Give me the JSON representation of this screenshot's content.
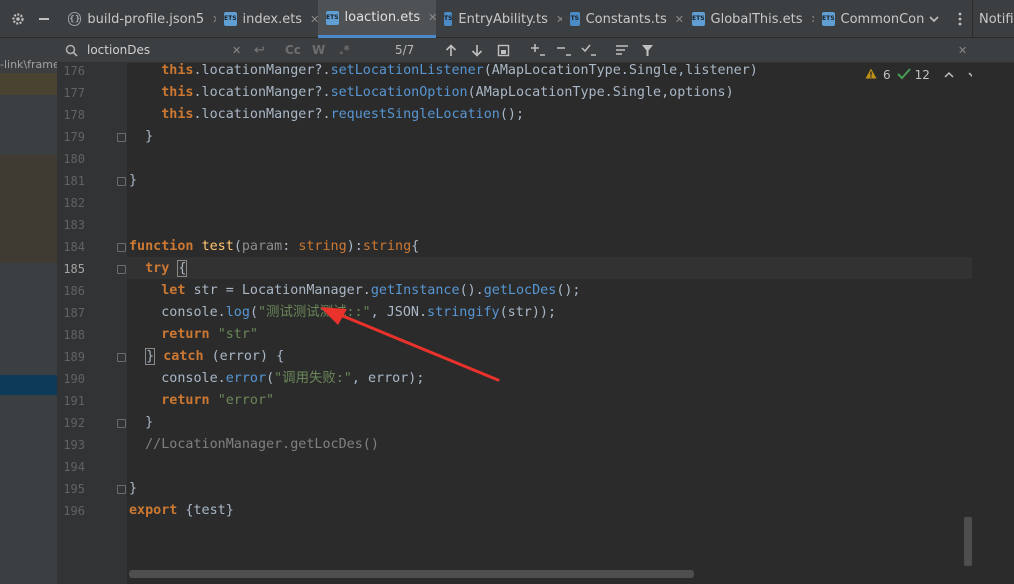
{
  "tabs": [
    {
      "name": "build-profile.json5",
      "icon": "json-file-icon",
      "badge": "{}",
      "active": false
    },
    {
      "name": "index.ets",
      "icon": "ets-file-icon",
      "badge": "ETS",
      "active": false
    },
    {
      "name": "loaction.ets",
      "icon": "ets-file-icon",
      "badge": "ETS",
      "active": true
    },
    {
      "name": "EntryAbility.ts",
      "icon": "ts-file-icon",
      "badge": "TS",
      "active": false
    },
    {
      "name": "Constants.ts",
      "icon": "ts-file-icon",
      "badge": "TS",
      "active": false
    },
    {
      "name": "GlobalThis.ets",
      "icon": "ets-file-icon",
      "badge": "ETS",
      "active": false
    },
    {
      "name": "CommonCon",
      "icon": "ets-file-icon",
      "badge": "ETS",
      "active": false
    }
  ],
  "notifications_label": "Notifi",
  "left_strip": {
    "breadcrumb": "-link\\frame"
  },
  "find": {
    "query": "loctionDes",
    "match_case": "Cc",
    "words": "W",
    "regex": ".*",
    "result_count": "5/7"
  },
  "inspections": {
    "warnings": "6",
    "ok": "12"
  },
  "cursor_line": 185,
  "code_lines": [
    {
      "n": "176",
      "html": "    <span class=\"kw\">this</span>.locationManger?.<span class=\"mt\">setLocationListener</span>(AMapLocationType.Single,listener)"
    },
    {
      "n": "177",
      "html": "    <span class=\"kw\">this</span>.locationManger?.<span class=\"mt\">setLocationOption</span>(AMapLocationType.Single,options)"
    },
    {
      "n": "178",
      "html": "    <span class=\"kw\">this</span>.locationManger?.<span class=\"mt\">requestSingleLocation</span>();"
    },
    {
      "n": "179",
      "html": "  }"
    },
    {
      "n": "180",
      "html": ""
    },
    {
      "n": "181",
      "html": "}"
    },
    {
      "n": "182",
      "html": ""
    },
    {
      "n": "183",
      "html": ""
    },
    {
      "n": "184",
      "html": "<span class=\"kw\">function</span> <span class=\"fn\">test</span>(<span class=\"param\">param</span>: <span class=\"ty\">string</span>):<span class=\"ty\">string</span>{"
    },
    {
      "n": "185",
      "html": "  <span class=\"kw\">try</span> <span class=\"brc\">{</span>"
    },
    {
      "n": "186",
      "html": "    <span class=\"kw\">let</span> str = LocationManager.<span class=\"mt\">getInstance</span>().<span class=\"mt\">getLocDes</span>();"
    },
    {
      "n": "187",
      "html": "    console.<span class=\"mt\">log</span>(<span class=\"str\">\"测试测试测试::\"</span>, JSON.<span class=\"mt\">stringify</span>(str));"
    },
    {
      "n": "188",
      "html": "    <span class=\"kw\">return</span> <span class=\"str\">\"str\"</span>"
    },
    {
      "n": "189",
      "html": "  <span class=\"brc\">}</span> <span class=\"kw\">catch</span> (error) {"
    },
    {
      "n": "190",
      "html": "    console.<span class=\"mt\">error</span>(<span class=\"str\">\"调用失败:\"</span>, error);"
    },
    {
      "n": "191",
      "html": "    <span class=\"kw\">return</span> <span class=\"str\">\"error\"</span>"
    },
    {
      "n": "192",
      "html": "  }"
    },
    {
      "n": "193",
      "html": "  <span class=\"cm\">//LocationManager.getLocDes()</span>"
    },
    {
      "n": "194",
      "html": ""
    },
    {
      "n": "195",
      "html": "}"
    },
    {
      "n": "196",
      "html": "<span class=\"kw\">export</span> {test}"
    }
  ],
  "colors": {
    "accent": "#4a88c7",
    "warning": "#be9117",
    "ok": "#499c54",
    "arrow": "#e8322b"
  }
}
